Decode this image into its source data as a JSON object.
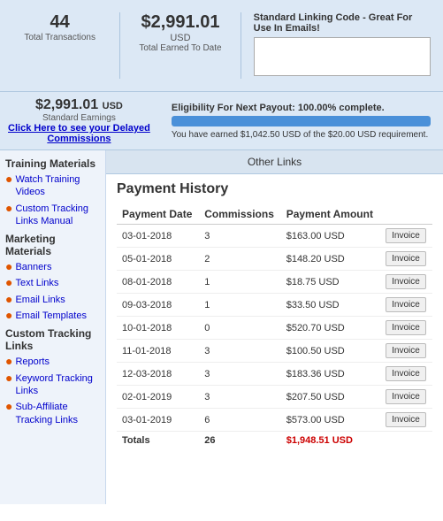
{
  "stats": {
    "transactions": {
      "count": "44",
      "label": "Total Transactions"
    },
    "earned": {
      "amount": "$2,991.01",
      "currency": "USD",
      "label": "Total Earned To Date"
    },
    "linking": {
      "title": "Standard Linking Code - Great For Use In Emails!",
      "placeholder": ""
    },
    "standard_earnings": {
      "amount": "$2,991.01",
      "currency_label": "USD",
      "label": "Standard Earnings",
      "link_text": "Click Here to see your Delayed Commissions"
    },
    "eligibility": {
      "title": "Eligibility For Next Payout: 100.00% complete.",
      "progress": 100,
      "text": "You have earned $1,042.50 USD of the $20.00 USD requirement."
    }
  },
  "sidebar": {
    "training_title": "Training Materials",
    "links_training": [
      {
        "label": "Watch Training Videos",
        "bullet": "❶"
      },
      {
        "label": "Custom Tracking Links Manual",
        "bullet": "❶"
      }
    ],
    "marketing_title": "Marketing Materials",
    "links_marketing": [
      {
        "label": "Banners",
        "bullet": "❶"
      },
      {
        "label": "Text Links",
        "bullet": "❶"
      },
      {
        "label": "Email Links",
        "bullet": "❶"
      },
      {
        "label": "Email Templates",
        "bullet": "❶"
      }
    ],
    "custom_title": "Custom Tracking Links",
    "links_custom": [
      {
        "label": "Reports",
        "bullet": "❶"
      },
      {
        "label": "Keyword Tracking Links",
        "bullet": "❶"
      },
      {
        "label": "Sub-Affiliate Tracking Links",
        "bullet": "❶"
      }
    ]
  },
  "other_links_tab": "Other Links",
  "payment_history": {
    "title": "Payment History",
    "columns": [
      "Payment Date",
      "Commissions",
      "Payment Amount",
      ""
    ],
    "rows": [
      {
        "date": "03-01-2018",
        "commissions": "3",
        "amount": "$163.00 USD",
        "has_invoice": true
      },
      {
        "date": "05-01-2018",
        "commissions": "2",
        "amount": "$148.20 USD",
        "has_invoice": true
      },
      {
        "date": "08-01-2018",
        "commissions": "1",
        "amount": "$18.75 USD",
        "has_invoice": true
      },
      {
        "date": "09-03-2018",
        "commissions": "1",
        "amount": "$33.50 USD",
        "has_invoice": true
      },
      {
        "date": "10-01-2018",
        "commissions": "0",
        "amount": "$520.70 USD",
        "has_invoice": true
      },
      {
        "date": "11-01-2018",
        "commissions": "3",
        "amount": "$100.50 USD",
        "has_invoice": true
      },
      {
        "date": "12-03-2018",
        "commissions": "3",
        "amount": "$183.36 USD",
        "has_invoice": true
      },
      {
        "date": "02-01-2019",
        "commissions": "3",
        "amount": "$207.50 USD",
        "has_invoice": true
      },
      {
        "date": "03-01-2019",
        "commissions": "6",
        "amount": "$573.00 USD",
        "has_invoice": true
      }
    ],
    "totals": {
      "label": "Totals",
      "commissions": "26",
      "amount": "$1,948.51 USD"
    },
    "invoice_label": "Invoice"
  }
}
